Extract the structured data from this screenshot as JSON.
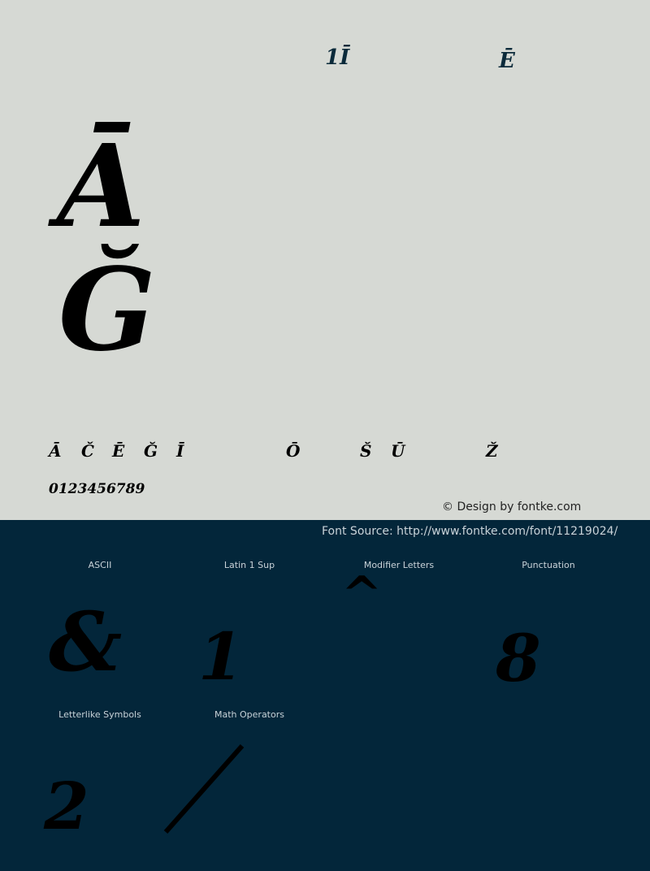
{
  "top_glyphs": [
    "1Ī",
    "Ē"
  ],
  "large_glyphs": [
    "Ā",
    "Ğ"
  ],
  "row_glyphs": [
    "Ā",
    "Č",
    "Ē",
    "Ğ",
    "Ī",
    "Ō",
    "Š",
    "Ū",
    "Ž"
  ],
  "digits": "0123456789",
  "credit": "© Design by fontke.com",
  "source": "Font Source: http://www.fontke.com/font/11219024/",
  "categories": [
    {
      "label": "ASCII",
      "glyph": "&"
    },
    {
      "label": "Latin 1 Sup",
      "glyph": "1"
    },
    {
      "label": "Modifier Letters",
      "glyph": "^"
    },
    {
      "label": "Punctuation",
      "glyph": "8"
    },
    {
      "label": "Letterlike Symbols",
      "glyph": "2"
    },
    {
      "label": "Math Operators",
      "glyph": "/"
    }
  ],
  "colors": {
    "background_top": "#d6d9d4",
    "background_bottom": "#03263a",
    "glyph_top": "#0b2a3a"
  }
}
